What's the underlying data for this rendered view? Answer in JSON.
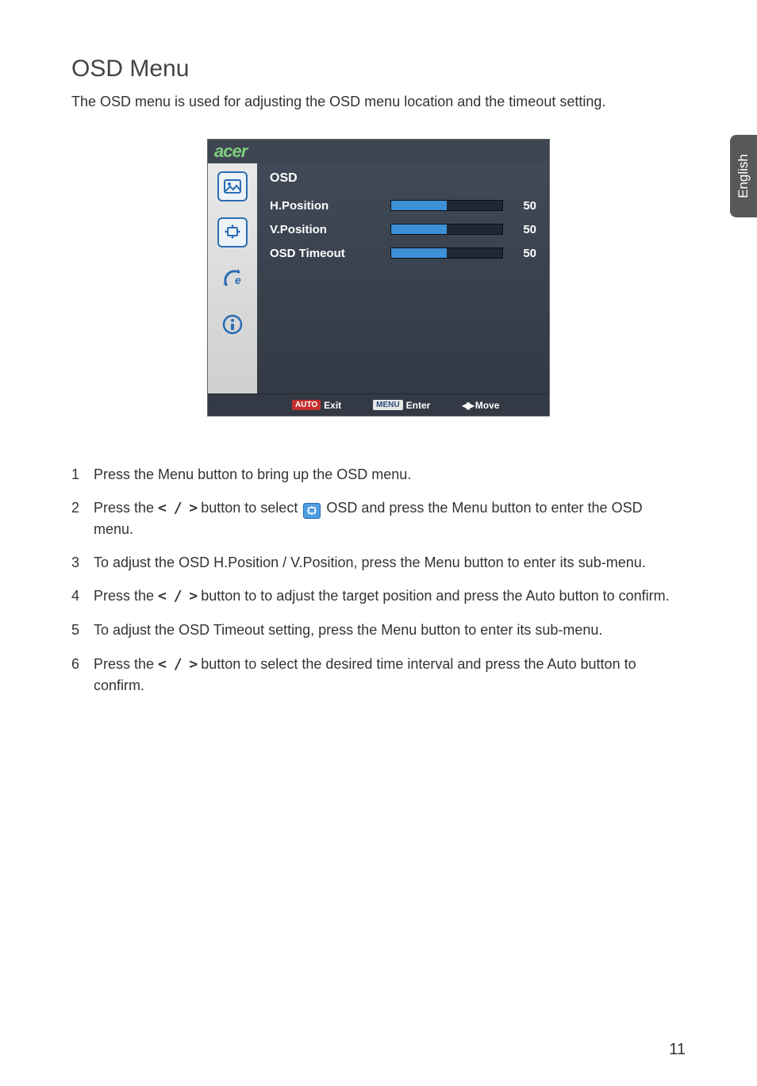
{
  "page": {
    "title": "OSD Menu",
    "intro": "The OSD menu is used for adjusting the OSD menu location and the timeout setting.",
    "language_tab": "English",
    "page_number": "11"
  },
  "osd": {
    "brand": "acer",
    "header": "OSD",
    "rows": [
      {
        "label": "H.Position",
        "value": "50"
      },
      {
        "label": "V.Position",
        "value": "50"
      },
      {
        "label": "OSD Timeout",
        "value": "50"
      }
    ],
    "footer": {
      "auto_tag": "AUTO",
      "auto_label": "Exit",
      "menu_tag": "MENU",
      "menu_label": "Enter",
      "move_label": "Move"
    },
    "side_icons": [
      "picture-icon",
      "osd-position-icon",
      "settings-icon",
      "info-icon"
    ]
  },
  "steps": {
    "s1_a": "Press the ",
    "s1_menu": "Menu",
    "s1_b": " button to bring up the OSD menu.",
    "s2_a": "Press the ",
    "s2_arrows": "< / >",
    "s2_b": " button to select ",
    "s2_c": " OSD and press the ",
    "s2_menu": "Menu",
    "s2_d": " button to enter the OSD menu.",
    "s3_a": "To adjust the OSD H.Position / V.Position, press the ",
    "s3_menu": "Menu",
    "s3_b": " button to enter its sub-menu.",
    "s4_a": "Press the ",
    "s4_arrows": "< / >",
    "s4_b": " button to to adjust the target position and press the ",
    "s4_auto": "Auto",
    "s4_c": " button to confirm.",
    "s5_a": "To adjust the ",
    "s5_term": "OSD Timeout",
    "s5_b": " setting, press the ",
    "s5_menu": "Menu",
    "s5_c": " button to enter its sub-menu.",
    "s6_a": "Press the ",
    "s6_arrows": "< / >",
    "s6_b": " button to select the desired time interval and press the ",
    "s6_auto": "Auto",
    "s6_c": " button to confirm."
  }
}
